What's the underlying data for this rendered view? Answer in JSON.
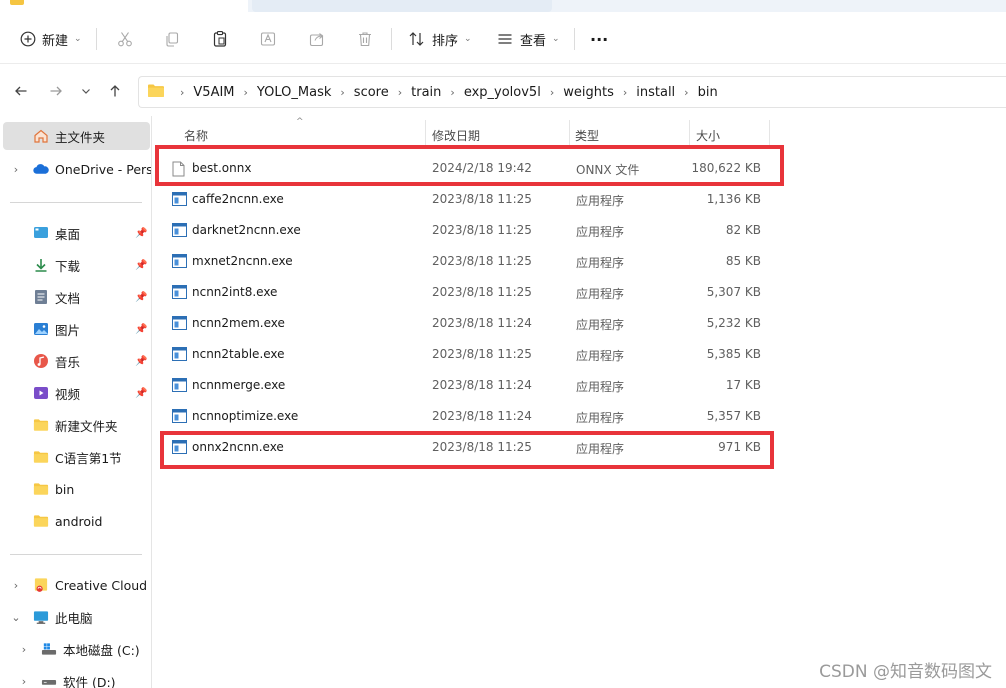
{
  "toolbar": {
    "new_label": "新建",
    "sort_label": "排序",
    "view_label": "查看",
    "more_label": "···"
  },
  "address": {
    "crumbs": [
      "V5AIM",
      "YOLO_Mask",
      "score",
      "train",
      "exp_yolov5l",
      "weights",
      "install",
      "bin"
    ]
  },
  "sidebar": {
    "home": "主文件夹",
    "onedrive": "OneDrive - Perso",
    "quick": [
      {
        "label": "桌面",
        "icon": "desktop-icon"
      },
      {
        "label": "下载",
        "icon": "download-icon"
      },
      {
        "label": "文档",
        "icon": "document-icon"
      },
      {
        "label": "图片",
        "icon": "picture-icon"
      },
      {
        "label": "音乐",
        "icon": "music-icon"
      },
      {
        "label": "视频",
        "icon": "video-icon"
      },
      {
        "label": "新建文件夹",
        "icon": "folder-icon"
      },
      {
        "label": "C语言第1节",
        "icon": "folder-icon"
      },
      {
        "label": "bin",
        "icon": "folder-icon"
      },
      {
        "label": "android",
        "icon": "folder-icon"
      }
    ],
    "creative_cloud": "Creative Cloud F",
    "this_pc": "此电脑",
    "drive_c": "本地磁盘 (C:)",
    "drive_d": "软件 (D:)"
  },
  "columns": {
    "name": "名称",
    "date": "修改日期",
    "type": "类型",
    "size": "大小"
  },
  "files": [
    {
      "name": "best.onnx",
      "date": "2024/2/18 19:42",
      "type": "ONNX 文件",
      "size": "180,622 KB",
      "kind": "doc"
    },
    {
      "name": "caffe2ncnn.exe",
      "date": "2023/8/18 11:25",
      "type": "应用程序",
      "size": "1,136 KB",
      "kind": "exe"
    },
    {
      "name": "darknet2ncnn.exe",
      "date": "2023/8/18 11:25",
      "type": "应用程序",
      "size": "82 KB",
      "kind": "exe"
    },
    {
      "name": "mxnet2ncnn.exe",
      "date": "2023/8/18 11:25",
      "type": "应用程序",
      "size": "85 KB",
      "kind": "exe"
    },
    {
      "name": "ncnn2int8.exe",
      "date": "2023/8/18 11:25",
      "type": "应用程序",
      "size": "5,307 KB",
      "kind": "exe"
    },
    {
      "name": "ncnn2mem.exe",
      "date": "2023/8/18 11:24",
      "type": "应用程序",
      "size": "5,232 KB",
      "kind": "exe"
    },
    {
      "name": "ncnn2table.exe",
      "date": "2023/8/18 11:25",
      "type": "应用程序",
      "size": "5,385 KB",
      "kind": "exe"
    },
    {
      "name": "ncnnmerge.exe",
      "date": "2023/8/18 11:24",
      "type": "应用程序",
      "size": "17 KB",
      "kind": "exe"
    },
    {
      "name": "ncnnoptimize.exe",
      "date": "2023/8/18 11:24",
      "type": "应用程序",
      "size": "5,357 KB",
      "kind": "exe"
    },
    {
      "name": "onnx2ncnn.exe",
      "date": "2023/8/18 11:25",
      "type": "应用程序",
      "size": "971 KB",
      "kind": "exe"
    }
  ],
  "highlight_color": "#e8343a",
  "watermark": "CSDN @知音数码图文"
}
